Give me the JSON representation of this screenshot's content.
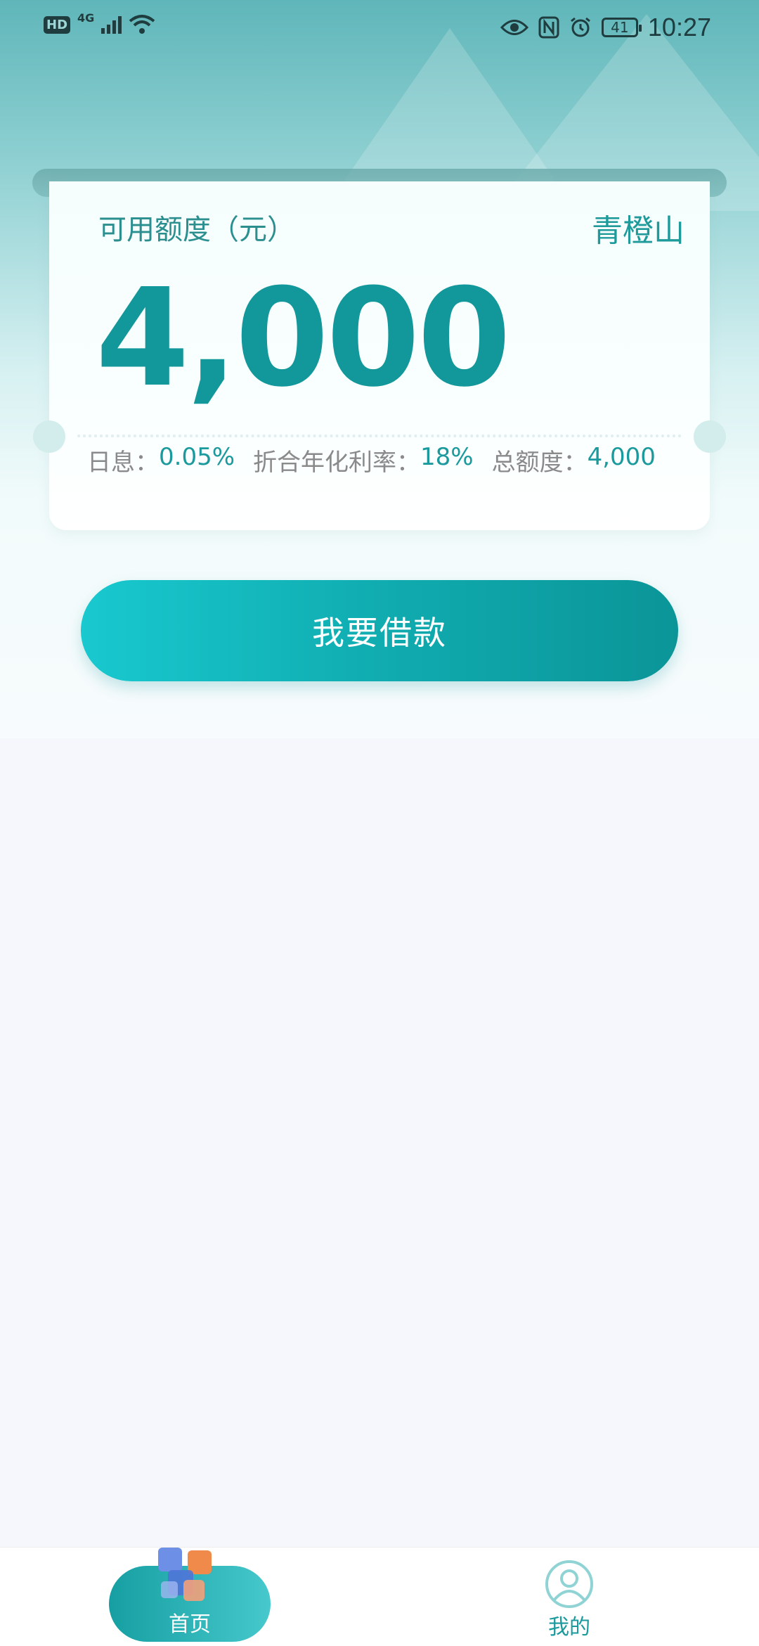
{
  "status_bar": {
    "hd": "HD",
    "network": "4G",
    "battery": "41",
    "time": "10:27"
  },
  "card": {
    "label": "可用额度（元）",
    "brand": "青橙山",
    "amount": "4,000",
    "daily_interest_label": "日息：",
    "daily_interest_value": "0.05%",
    "annual_rate_label": "折合年化利率：",
    "annual_rate_value": "18%",
    "total_label": "总额度：",
    "total_value": "4,000"
  },
  "actions": {
    "borrow_label": "我要借款"
  },
  "tabbar": {
    "home_label": "首页",
    "me_label": "我的"
  },
  "colors": {
    "accent": "#12979a",
    "button_start": "#18c9cf",
    "button_end": "#0b9598",
    "page_bg": "#f5f7fc"
  }
}
